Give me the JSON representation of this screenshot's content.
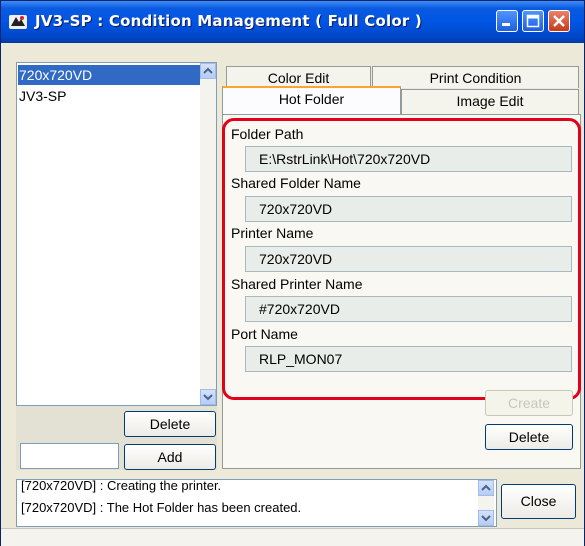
{
  "window": {
    "title": "JV3-SP : Condition Management ( Full Color )"
  },
  "colors": {
    "titlebar": "#0055e5",
    "selection": "#316ac5",
    "highlight": "#e3001b",
    "tab_accent": "#f8a532"
  },
  "profiles": {
    "items": [
      {
        "label": "720x720VD",
        "selected": true
      },
      {
        "label": "JV3-SP",
        "selected": false
      }
    ],
    "delete_label": "Delete",
    "add_label": "Add",
    "add_value": ""
  },
  "tabs": {
    "color_edit": "Color Edit",
    "print_condition": "Print Condition",
    "hot_folder": "Hot Folder",
    "image_edit": "Image Edit",
    "active": "Hot Folder"
  },
  "hot_folder": {
    "folder_path_label": "Folder Path",
    "folder_path": "E:\\RstrLink\\Hot\\720x720VD",
    "shared_folder_label": "Shared Folder Name",
    "shared_folder": "720x720VD",
    "printer_name_label": "Printer Name",
    "printer_name": "720x720VD",
    "shared_printer_label": "Shared Printer Name",
    "shared_printer": "#720x720VD",
    "port_name_label": "Port Name",
    "port_name": "RLP_MON07",
    "create_label": "Create",
    "delete_label": "Delete"
  },
  "log": {
    "lines": [
      "[720x720VD] : Creating the printer.",
      "[720x720VD] : The Hot Folder has been created."
    ]
  },
  "close_label": "Close"
}
